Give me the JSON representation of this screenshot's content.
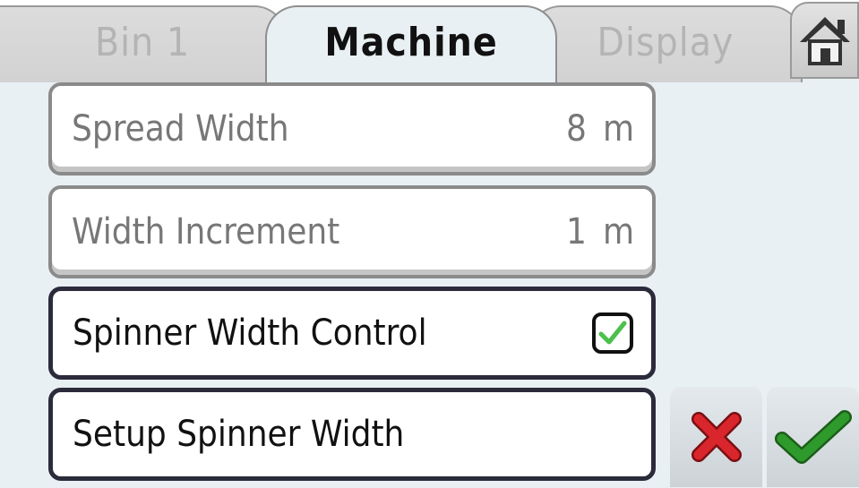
{
  "tabs": [
    {
      "label": "Bin 1",
      "active": false
    },
    {
      "label": "Machine",
      "active": true
    },
    {
      "label": "Display",
      "active": false
    }
  ],
  "home_icon": "home-icon",
  "rows": [
    {
      "label": "Spread Width",
      "value": "8",
      "unit": "m",
      "enabled": false
    },
    {
      "label": "Width Increment",
      "value": "1",
      "unit": "m",
      "enabled": false
    },
    {
      "label": "Spinner Width Control",
      "checked": true,
      "enabled": true
    },
    {
      "label": "Setup Spinner Width",
      "enabled": true
    }
  ],
  "actions": {
    "cancel_icon": "red-x-icon",
    "confirm_icon": "green-check-icon"
  },
  "colors": {
    "background": "#e9f0f4",
    "cancel": "#d9262c",
    "confirm": "#2f9a2c",
    "check": "#4cc04c"
  }
}
